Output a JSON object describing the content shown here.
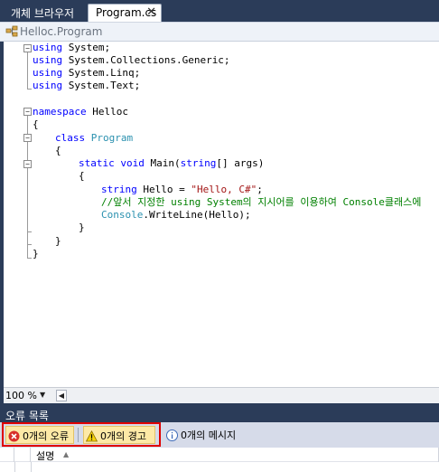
{
  "tabs": {
    "inactive_label": "개체 브라우저",
    "active_label": "Program.cs",
    "close_glyph": "✕"
  },
  "navbar": {
    "icon": "class-icon",
    "text": "Helloc.Program"
  },
  "code": {
    "line1_kw": "using",
    "line1_rest": " System;",
    "line2_kw": "using",
    "line2_rest": " System.Collections.Generic;",
    "line3_kw": "using",
    "line3_rest": " System.Linq;",
    "line4_kw": "using",
    "line4_rest": " System.Text;",
    "ns_kw": "namespace",
    "ns_name": " Helloc",
    "brace_open": "{",
    "brace_close": "}",
    "class_kw": "class",
    "class_name": " Program",
    "static_kw": "static",
    "void_kw": " void",
    "main_sig_1": " Main(",
    "string_kw": "string",
    "main_sig_2": "[] args)",
    "var_type": "string",
    "var_decl": " Hello = ",
    "var_value": "\"Hello, C#\"",
    "semicolon": ";",
    "comment": "//앞서 지정한 using System의 지시어를 이용하여 Console클래스에",
    "console_type": "Console",
    "console_call": ".WriteLine(Hello);"
  },
  "zoombar": {
    "zoom_value": "100 %",
    "dropdown_glyph": "▼",
    "scroll_left_glyph": "◀"
  },
  "error_list": {
    "title": "오류 목록",
    "errors_label": "0개의 오류",
    "warnings_label": "0개의 경고",
    "messages_label": "0개의 메시지",
    "column_description": "설명",
    "sort_glyph": "▲"
  },
  "colors": {
    "frame": "#2b3c59",
    "keyword": "#0000ff",
    "type": "#2b91af",
    "string": "#a31515",
    "comment": "#008000",
    "highlight_border": "#e00000",
    "toggle_on": "#fde9a6"
  }
}
